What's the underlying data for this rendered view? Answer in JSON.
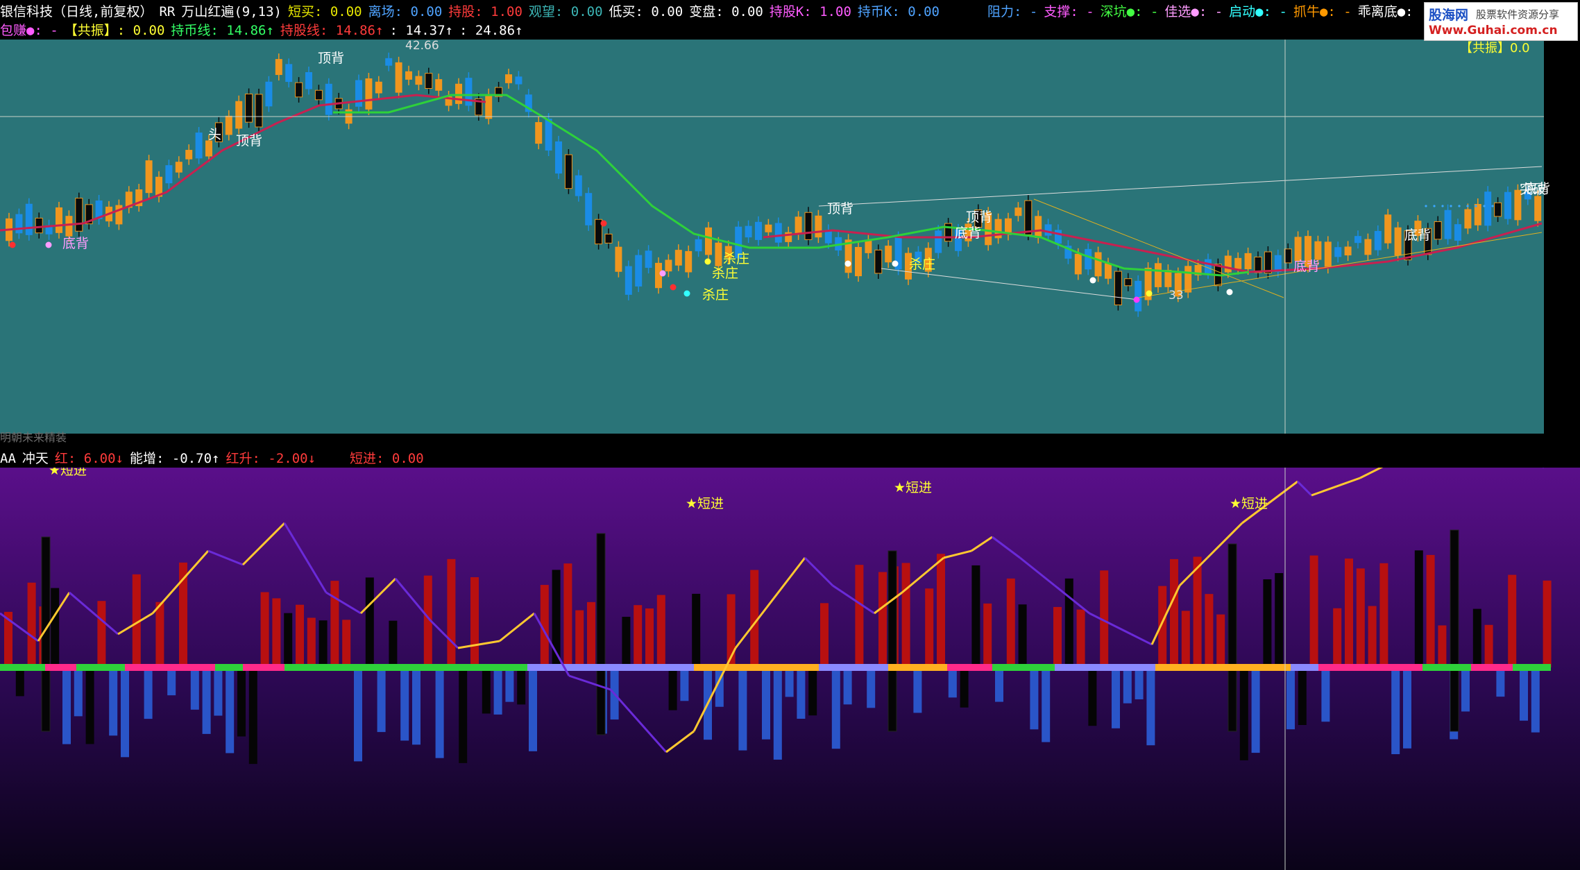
{
  "header_main": {
    "items": [
      {
        "text": "银信科技（日线,前复权）",
        "color": "#ffffff"
      },
      {
        "text": "RR",
        "color": "#ffffff"
      },
      {
        "text": "万山红遍(9,13)",
        "color": "#ffffff"
      },
      {
        "text": "短买: 0.00",
        "color": "#e8e800"
      },
      {
        "text": "离场: 0.00",
        "color": "#4fa3ff"
      },
      {
        "text": "持股: 1.00",
        "color": "#ff3b3b"
      },
      {
        "text": "观望: 0.00",
        "color": "#3cb6b6"
      },
      {
        "text": "低买: 0.00",
        "color": "#ffffff"
      },
      {
        "text": "变盘: 0.00",
        "color": "#ffffff"
      },
      {
        "text": "持股K: 1.00",
        "color": "#ff5cff"
      },
      {
        "text": "持币K: 0.00",
        "color": "#4fa3ff"
      }
    ],
    "signals": [
      {
        "text": "阻力: -",
        "color": "#4fa3ff"
      },
      {
        "text": "支撑: -",
        "color": "#ff5cff"
      },
      {
        "text": "深坑●: -",
        "color": "#44ff44"
      },
      {
        "text": "佳选●: -",
        "color": "#ff9cff"
      },
      {
        "text": "启动●: -",
        "color": "#33ffff"
      },
      {
        "text": "抓牛●: -",
        "color": "#ff9900"
      },
      {
        "text": "乖离底●:",
        "color": "#ffffff"
      }
    ]
  },
  "header_second": {
    "items": [
      {
        "text": "包赚●: -",
        "color": "#ff5cff"
      },
      {
        "text": "【共振】: 0.00",
        "color": "#ffff33"
      },
      {
        "text": "持币线: 14.86↑",
        "color": "#33ff66"
      },
      {
        "text": "持股线: 14.86↑",
        "color": "#ff3b3b"
      },
      {
        "text": ": 14.37↑",
        "color": "#ffffff"
      },
      {
        "text": ": 24.86↑",
        "color": "#ffffff"
      }
    ]
  },
  "main_chart": {
    "resonance_label": "【共振】0.0",
    "price_high_label": "42.66",
    "price_low_label": "33",
    "annotations": [
      "顶背",
      "顶背",
      "头",
      "底背",
      "顶背",
      "顶背",
      "底背",
      "底背",
      "底背",
      "杀庄",
      "杀庄",
      "杀庄",
      "杀庄",
      "突破",
      "底背"
    ]
  },
  "separator_label": "明朝未来精装",
  "header_sub": {
    "items": [
      {
        "text": "AA",
        "color": "#ffffff"
      },
      {
        "text": "冲天",
        "color": "#ffffff"
      },
      {
        "text": "红: 6.00↓",
        "color": "#ff3b3b"
      },
      {
        "text": "能增: -0.70↑",
        "color": "#ffffff"
      },
      {
        "text": "红升: -2.00↓",
        "color": "#ff3b3b"
      },
      {
        "text": "短进: 0.00",
        "color": "#ff3b3b"
      }
    ],
    "short_entry_label": "★短进"
  },
  "logo": {
    "line1": "股海网",
    "line1b": "股票软件资源分享",
    "line2": "Www.Guhai.com.cn"
  },
  "colors": {
    "main_bg": "#2a7478",
    "candle_up": "#f0961e",
    "candle_dn": "#1a8ce6",
    "candle_dk": "#0a0a0a",
    "ma_red": "#c82050",
    "ma_green": "#2ed13a",
    "sub_red": "#b81010",
    "sub_blue": "#2a55c8",
    "line_yellow": "#ffc830",
    "line_purple": "#6a2ad8"
  }
}
